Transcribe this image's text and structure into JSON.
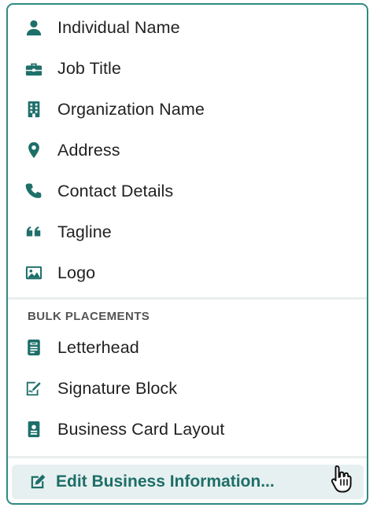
{
  "colors": {
    "accent": "#1e6f69",
    "border": "#2f8a83",
    "text": "#222222",
    "section_header": "#555555",
    "edit_bg": "#e7f0f0"
  },
  "menu": {
    "items": [
      {
        "label": "Individual Name",
        "icon": "person-icon"
      },
      {
        "label": "Job Title",
        "icon": "briefcase-icon"
      },
      {
        "label": "Organization Name",
        "icon": "building-icon"
      },
      {
        "label": "Address",
        "icon": "map-pin-icon"
      },
      {
        "label": "Contact Details",
        "icon": "phone-icon"
      },
      {
        "label": "Tagline",
        "icon": "quote-icon"
      },
      {
        "label": "Logo",
        "icon": "image-icon"
      }
    ],
    "bulk_header": "BULK PLACEMENTS",
    "bulk_items": [
      {
        "label": "Letterhead",
        "icon": "letterhead-icon"
      },
      {
        "label": "Signature Block",
        "icon": "signature-icon"
      },
      {
        "label": "Business Card Layout",
        "icon": "id-card-icon"
      }
    ],
    "edit": {
      "label": "Edit Business Information...",
      "icon": "edit-icon"
    }
  }
}
